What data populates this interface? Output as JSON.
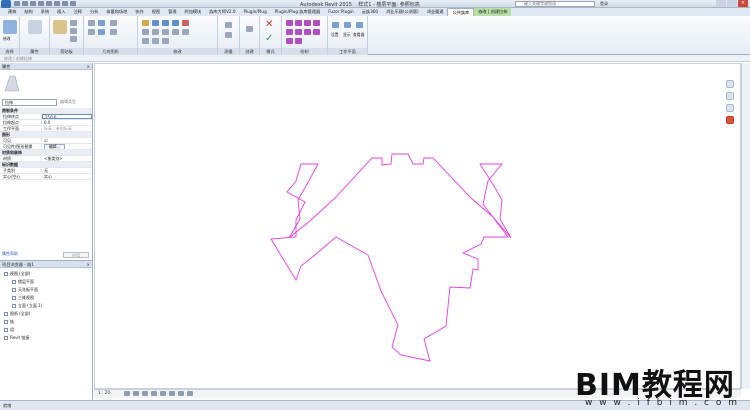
{
  "titlebar": {
    "title": "Autodesk Revit 2015",
    "subtitle": "样式1 - 楼层平面: 参照标高",
    "search_placeholder": "键入关键字或短语",
    "sign_in": "登录",
    "close_glyph": "×"
  },
  "ribbon_tabs": [
    "建筑",
    "结构",
    "系统",
    "插入",
    "注释",
    "分析",
    "体量和场地",
    "协作",
    "视图",
    "管理",
    "附加模块",
    "族库大师V2.0",
    "Plugin/Plug",
    "Plugin/Plug 族库管理器",
    "Fuzor Plugin",
    "云族360",
    "鸿业乐建(公测版)",
    "鸿业暖通",
    "公共族库",
    "修改 | 创建拉伸"
  ],
  "ribbon_active_tab_index": 18,
  "ribbon_ctx_tab_index": 19,
  "ribbon_panels": [
    "选择",
    "属性",
    "剪贴板",
    "几何图形",
    "修改",
    "测量",
    "创建",
    "模式",
    "绘制",
    "工作平面"
  ],
  "ribbon_buttons": {
    "modify": "修改",
    "set": "设置",
    "show": "显示",
    "viewer": "查看器"
  },
  "optionsbar_text": "修改 | 创建拉伸",
  "properties": {
    "title": "属性",
    "close_glyph": "×",
    "type_select": "拉伸",
    "edit_type": "编辑类型",
    "rows": [
      {
        "group": "限制条件"
      },
      {
        "name": "拉伸终点",
        "value": "250.0",
        "state": "editing"
      },
      {
        "name": "拉伸起点",
        "value": "0.0"
      },
      {
        "name": "工作平面",
        "value": "标高 : 参照标高",
        "state": "disabled"
      },
      {
        "group": "图形"
      },
      {
        "name": "可见",
        "value": "☑"
      },
      {
        "name": "可见性/图形替换",
        "value": "编辑...",
        "state": "button"
      },
      {
        "group": "材质和装饰"
      },
      {
        "name": "材质",
        "value": "<按类别>"
      },
      {
        "group": "标识数据"
      },
      {
        "name": "子类别",
        "value": "无"
      },
      {
        "name": "实心/空心",
        "value": "实心"
      }
    ],
    "help_link": "属性帮助",
    "apply_label": "应用"
  },
  "project_browser": {
    "title": "项目浏览器 - 族1",
    "close_glyph": "×",
    "items": [
      {
        "label": "视图 (全部)",
        "indent": 0
      },
      {
        "label": "楼层平面",
        "indent": 1
      },
      {
        "label": "天花板平面",
        "indent": 1
      },
      {
        "label": "三维视图",
        "indent": 1
      },
      {
        "label": "立面 (立面 1)",
        "indent": 1
      },
      {
        "label": "图纸 (全部)",
        "indent": 0
      },
      {
        "label": "族",
        "indent": 0
      },
      {
        "label": "组",
        "indent": 0
      },
      {
        "label": "Revit 链接",
        "indent": 0
      }
    ]
  },
  "view_control": {
    "scale": "1 : 20"
  },
  "statusbar": {
    "text": "就绪"
  },
  "watermark": {
    "brand": "BIM教程网",
    "url": "w w w . i f b i m . c o m"
  },
  "colors": {
    "sketch_line": "#e040e0",
    "ribbon_bg": "#e7edf5",
    "context_tab": "#b7e0a5"
  },
  "icons": [
    "modify-arrow-icon",
    "properties-icon",
    "paste-icon",
    "cut-icon",
    "join-icon",
    "align-icon",
    "move-icon",
    "rotate-icon",
    "mirror-icon",
    "trim-icon",
    "array-icon",
    "measure-icon",
    "create-icon",
    "cancel-x-icon",
    "finish-check-icon",
    "line-icon",
    "rectangle-icon",
    "polygon-icon",
    "circle-icon",
    "arc-icon",
    "spline-icon",
    "set-workplane-icon",
    "show-workplane-icon",
    "viewer-icon"
  ]
}
